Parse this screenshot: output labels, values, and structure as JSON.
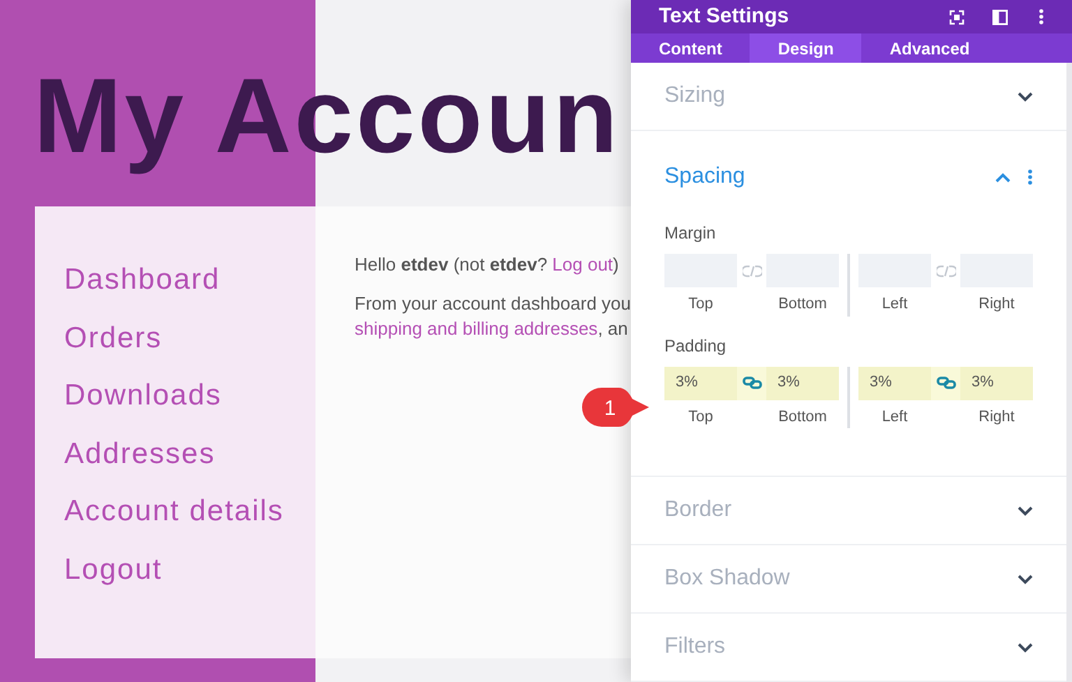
{
  "page": {
    "title": "My Accoun",
    "nav": [
      {
        "label": "Dashboard"
      },
      {
        "label": "Orders"
      },
      {
        "label": "Downloads"
      },
      {
        "label": "Addresses"
      },
      {
        "label": "Account details"
      },
      {
        "label": "Logout"
      }
    ],
    "greeting": {
      "text": "Hello **etdev** (not **etdev**? ",
      "link": "Log out",
      "end": ")"
    },
    "intro": {
      "line_1": "From your account dashboard you",
      "link": "shipping and billing addresses",
      "end": ", an"
    }
  },
  "panel": {
    "title": "Text Settings",
    "tabs": [
      {
        "label": "Content",
        "selected": false
      },
      {
        "label": "Design",
        "selected": true
      },
      {
        "label": "Advanced",
        "selected": false
      }
    ],
    "sections": [
      {
        "title": "Sizing",
        "expanded": false
      },
      {
        "title": "Spacing",
        "expanded": true,
        "groups": [
          {
            "label": "Margin",
            "modified": false,
            "pairs": [
              {
                "linked": false,
                "fields": [
                  {
                    "caption": "Top"
                  },
                  {
                    "caption": "Bottom"
                  }
                ]
              },
              {
                "linked": false,
                "fields": [
                  {
                    "caption": "Left"
                  },
                  {
                    "caption": "Right"
                  }
                ]
              }
            ]
          },
          {
            "label": "Padding",
            "modified": true,
            "pairs": [
              {
                "linked": true,
                "fields": [
                  {
                    "value": "3%",
                    "caption": "Top"
                  },
                  {
                    "value": "3%",
                    "caption": "Bottom"
                  }
                ]
              },
              {
                "linked": true,
                "fields": [
                  {
                    "value": "3%",
                    "caption": "Left"
                  },
                  {
                    "value": "3%",
                    "caption": "Right"
                  }
                ]
              }
            ]
          }
        ]
      },
      {
        "title": "Border",
        "expanded": false
      },
      {
        "title": "Box Shadow",
        "expanded": false
      },
      {
        "title": "Filters",
        "expanded": false
      }
    ]
  },
  "callout": {
    "text": "1"
  }
}
